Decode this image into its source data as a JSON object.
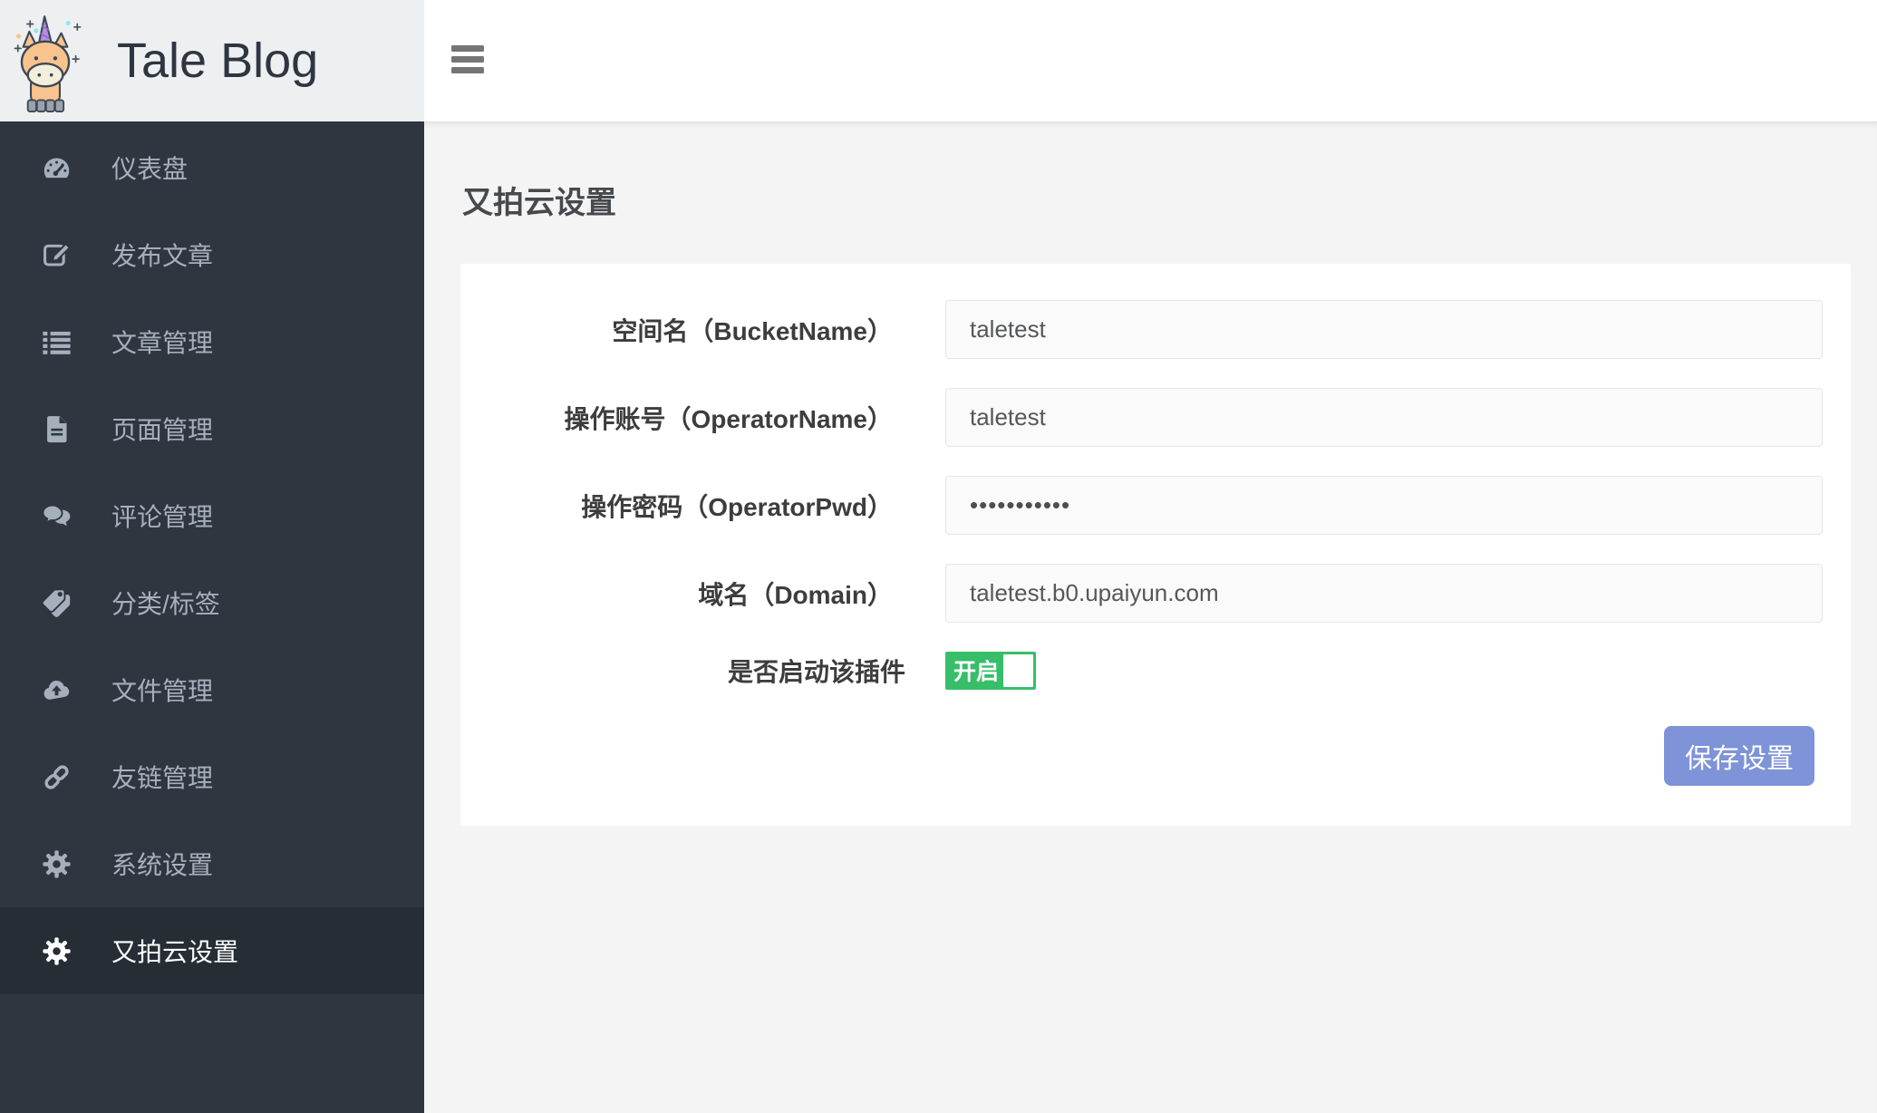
{
  "app": {
    "logo_text": "Tale Blog",
    "logo_icon": "unicorn-icon"
  },
  "sidebar": {
    "items": [
      {
        "label": "仪表盘",
        "icon": "dashboard-icon",
        "active": false
      },
      {
        "label": "发布文章",
        "icon": "edit-icon",
        "active": false
      },
      {
        "label": "文章管理",
        "icon": "list-icon",
        "active": false
      },
      {
        "label": "页面管理",
        "icon": "page-icon",
        "active": false
      },
      {
        "label": "评论管理",
        "icon": "comments-icon",
        "active": false
      },
      {
        "label": "分类/标签",
        "icon": "tags-icon",
        "active": false
      },
      {
        "label": "文件管理",
        "icon": "cloud-upload-icon",
        "active": false
      },
      {
        "label": "友链管理",
        "icon": "link-icon",
        "active": false
      },
      {
        "label": "系统设置",
        "icon": "gear-icon",
        "active": false
      },
      {
        "label": "又拍云设置",
        "icon": "gear-icon",
        "active": true
      }
    ]
  },
  "header": {
    "menu_icon": "hamburger-icon"
  },
  "main": {
    "page_title": "又拍云设置",
    "form": {
      "fields": [
        {
          "label": "空间名（BucketName）",
          "value": "taletest"
        },
        {
          "label": "操作账号（OperatorName）",
          "value": "taletest"
        },
        {
          "label": "操作密码（OperatorPwd）",
          "value": "•••••••••••",
          "masked": true
        },
        {
          "label": "域名（Domain）",
          "value": "taletest.b0.upaiyun.com"
        }
      ],
      "toggle": {
        "label": "是否启动该插件",
        "state_label": "开启",
        "enabled": true
      },
      "save_button_label": "保存设置"
    }
  },
  "colors": {
    "sidebar_bg": "#2f3640",
    "sidebar_active_bg": "#262d35",
    "sidebar_text": "#a6b0bc",
    "logo_strip_bg": "#eeeff0",
    "logo_text": "#2e3641",
    "content_bg": "#f4f4f4",
    "card_bg": "#ffffff",
    "input_bg": "#fafafa",
    "input_border": "#e7e7e7",
    "toggle_on_green": "#36be69",
    "save_button_blue": "#7e93d8"
  }
}
